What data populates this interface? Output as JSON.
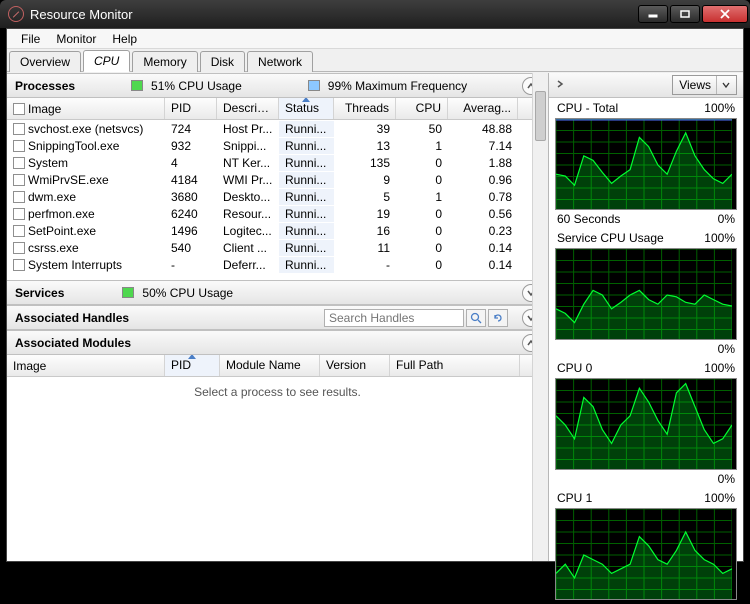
{
  "window": {
    "title": "Resource Monitor"
  },
  "menu": {
    "file": "File",
    "monitor": "Monitor",
    "help": "Help"
  },
  "tabs": {
    "overview": "Overview",
    "cpu": "CPU",
    "memory": "Memory",
    "disk": "Disk",
    "network": "Network"
  },
  "processes": {
    "title": "Processes",
    "cpu_usage": "51% CPU Usage",
    "max_freq": "99% Maximum Frequency",
    "headers": {
      "image": "Image",
      "pid": "PID",
      "desc": "Descrip...",
      "status": "Status",
      "threads": "Threads",
      "cpu": "CPU",
      "avg": "Averag..."
    },
    "rows": [
      {
        "img": "svchost.exe (netsvcs)",
        "pid": "724",
        "desc": "Host Pr...",
        "stat": "Runni...",
        "thr": "39",
        "cpu": "50",
        "avg": "48.88"
      },
      {
        "img": "SnippingTool.exe",
        "pid": "932",
        "desc": "Snippi...",
        "stat": "Runni...",
        "thr": "13",
        "cpu": "1",
        "avg": "7.14"
      },
      {
        "img": "System",
        "pid": "4",
        "desc": "NT Ker...",
        "stat": "Runni...",
        "thr": "135",
        "cpu": "0",
        "avg": "1.88"
      },
      {
        "img": "WmiPrvSE.exe",
        "pid": "4184",
        "desc": "WMI Pr...",
        "stat": "Runni...",
        "thr": "9",
        "cpu": "0",
        "avg": "0.96"
      },
      {
        "img": "dwm.exe",
        "pid": "3680",
        "desc": "Deskto...",
        "stat": "Runni...",
        "thr": "5",
        "cpu": "1",
        "avg": "0.78"
      },
      {
        "img": "perfmon.exe",
        "pid": "6240",
        "desc": "Resour...",
        "stat": "Runni...",
        "thr": "19",
        "cpu": "0",
        "avg": "0.56"
      },
      {
        "img": "SetPoint.exe",
        "pid": "1496",
        "desc": "Logitec...",
        "stat": "Runni...",
        "thr": "16",
        "cpu": "0",
        "avg": "0.23"
      },
      {
        "img": "csrss.exe",
        "pid": "540",
        "desc": "Client ...",
        "stat": "Runni...",
        "thr": "11",
        "cpu": "0",
        "avg": "0.14"
      },
      {
        "img": "System Interrupts",
        "pid": "-",
        "desc": "Deferr...",
        "stat": "Runni...",
        "thr": "-",
        "cpu": "0",
        "avg": "0.14"
      }
    ]
  },
  "services": {
    "title": "Services",
    "cpu_usage": "50% CPU Usage"
  },
  "handles": {
    "title": "Associated Handles",
    "search_placeholder": "Search Handles"
  },
  "modules": {
    "title": "Associated Modules",
    "headers": {
      "image": "Image",
      "pid": "PID",
      "mod": "Module Name",
      "ver": "Version",
      "full": "Full Path"
    },
    "empty": "Select a process to see results."
  },
  "right": {
    "views": "Views",
    "charts": [
      {
        "title": "CPU - Total",
        "topright": "100%",
        "botleft": "60 Seconds",
        "botright": "0%"
      },
      {
        "title": "Service CPU Usage",
        "topright": "100%",
        "botleft": "",
        "botright": "0%"
      },
      {
        "title": "CPU 0",
        "topright": "100%",
        "botleft": "",
        "botright": "0%"
      },
      {
        "title": "CPU 1",
        "topright": "100%",
        "botleft": "",
        "botright": ""
      }
    ]
  },
  "chart_data": [
    {
      "type": "line",
      "title": "CPU - Total",
      "ylim": [
        0,
        100
      ],
      "xlabel": "60 Seconds",
      "ylabel": "%",
      "series": [
        {
          "name": "Maximum Frequency",
          "values": [
            99,
            99,
            99,
            99,
            99,
            99,
            99,
            99,
            99,
            99,
            99,
            99,
            99,
            99,
            99,
            99,
            99,
            99,
            99,
            99
          ]
        },
        {
          "name": "CPU Usage",
          "values": [
            40,
            38,
            28,
            60,
            55,
            42,
            30,
            38,
            45,
            80,
            70,
            50,
            40,
            65,
            85,
            60,
            45,
            35,
            30,
            40
          ]
        }
      ]
    },
    {
      "type": "line",
      "title": "Service CPU Usage",
      "ylim": [
        0,
        100
      ],
      "ylabel": "%",
      "series": [
        {
          "name": "CPU",
          "values": [
            35,
            30,
            20,
            40,
            55,
            50,
            35,
            42,
            50,
            55,
            45,
            40,
            50,
            48,
            42,
            40,
            50,
            45,
            40,
            38
          ]
        }
      ]
    },
    {
      "type": "line",
      "title": "CPU 0",
      "ylim": [
        0,
        100
      ],
      "ylabel": "%",
      "series": [
        {
          "name": "CPU",
          "values": [
            60,
            50,
            35,
            80,
            70,
            45,
            30,
            50,
            60,
            90,
            75,
            55,
            40,
            85,
            95,
            70,
            45,
            30,
            35,
            50
          ]
        }
      ]
    },
    {
      "type": "line",
      "title": "CPU 1",
      "ylim": [
        0,
        100
      ],
      "ylabel": "%",
      "series": [
        {
          "name": "CPU",
          "values": [
            30,
            40,
            25,
            50,
            45,
            40,
            30,
            35,
            40,
            70,
            60,
            45,
            40,
            55,
            75,
            55,
            45,
            40,
            30,
            35
          ]
        }
      ]
    }
  ]
}
